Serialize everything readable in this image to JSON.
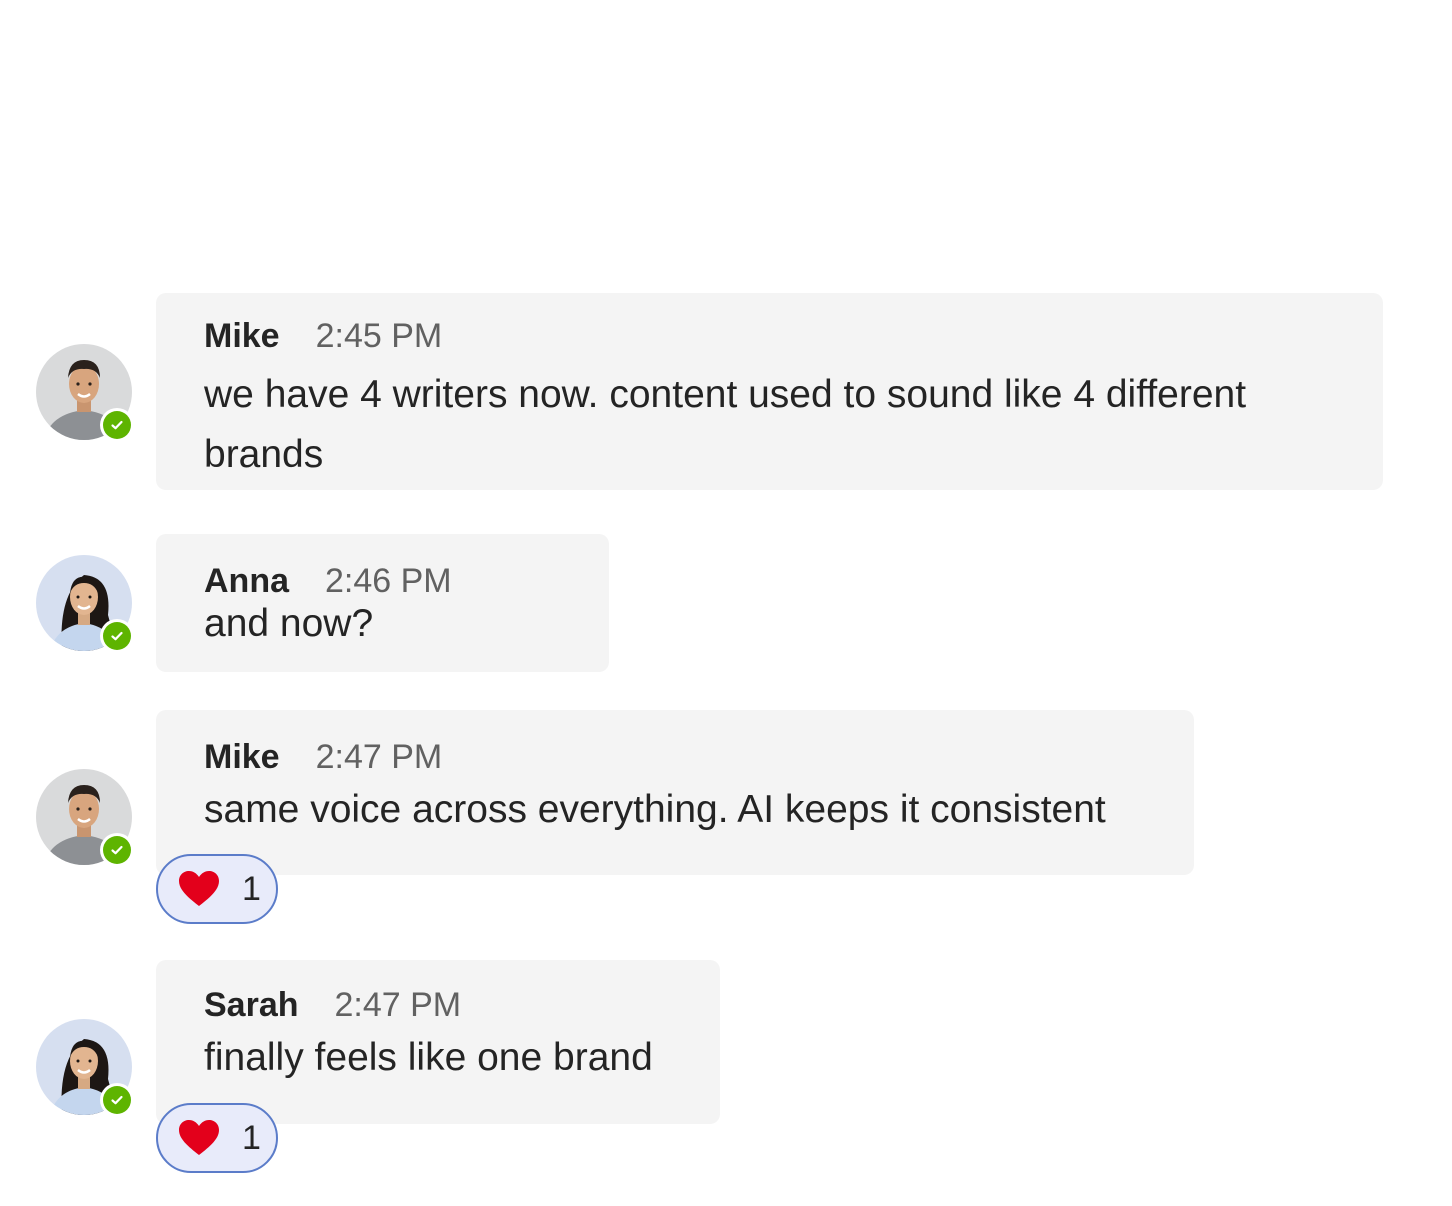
{
  "messages": [
    {
      "author": "Mike",
      "time": "2:45 PM",
      "text": "we have 4 writers now. content used to sound like 4 different brands",
      "avatar": "mike-avatar",
      "presence": "available"
    },
    {
      "author": "Anna",
      "time": "2:46 PM",
      "text": "and now?",
      "avatar": "anna-avatar",
      "presence": "available"
    },
    {
      "author": "Mike",
      "time": "2:47 PM",
      "text": "same voice across everything. AI keeps it consistent",
      "avatar": "mike-avatar",
      "presence": "available",
      "reaction": {
        "icon": "heart-icon",
        "count": "1"
      }
    },
    {
      "author": "Sarah",
      "time": "2:47 PM",
      "text": "finally feels like one brand",
      "avatar": "sarah-avatar",
      "presence": "available",
      "reaction": {
        "icon": "heart-icon",
        "count": "1"
      }
    }
  ],
  "colors": {
    "bubble": "#f4f4f4",
    "presence_available": "#5eb400",
    "reaction_bg": "#e8ebfa",
    "reaction_border": "#5b7cc9",
    "heart": "#e3001b"
  }
}
